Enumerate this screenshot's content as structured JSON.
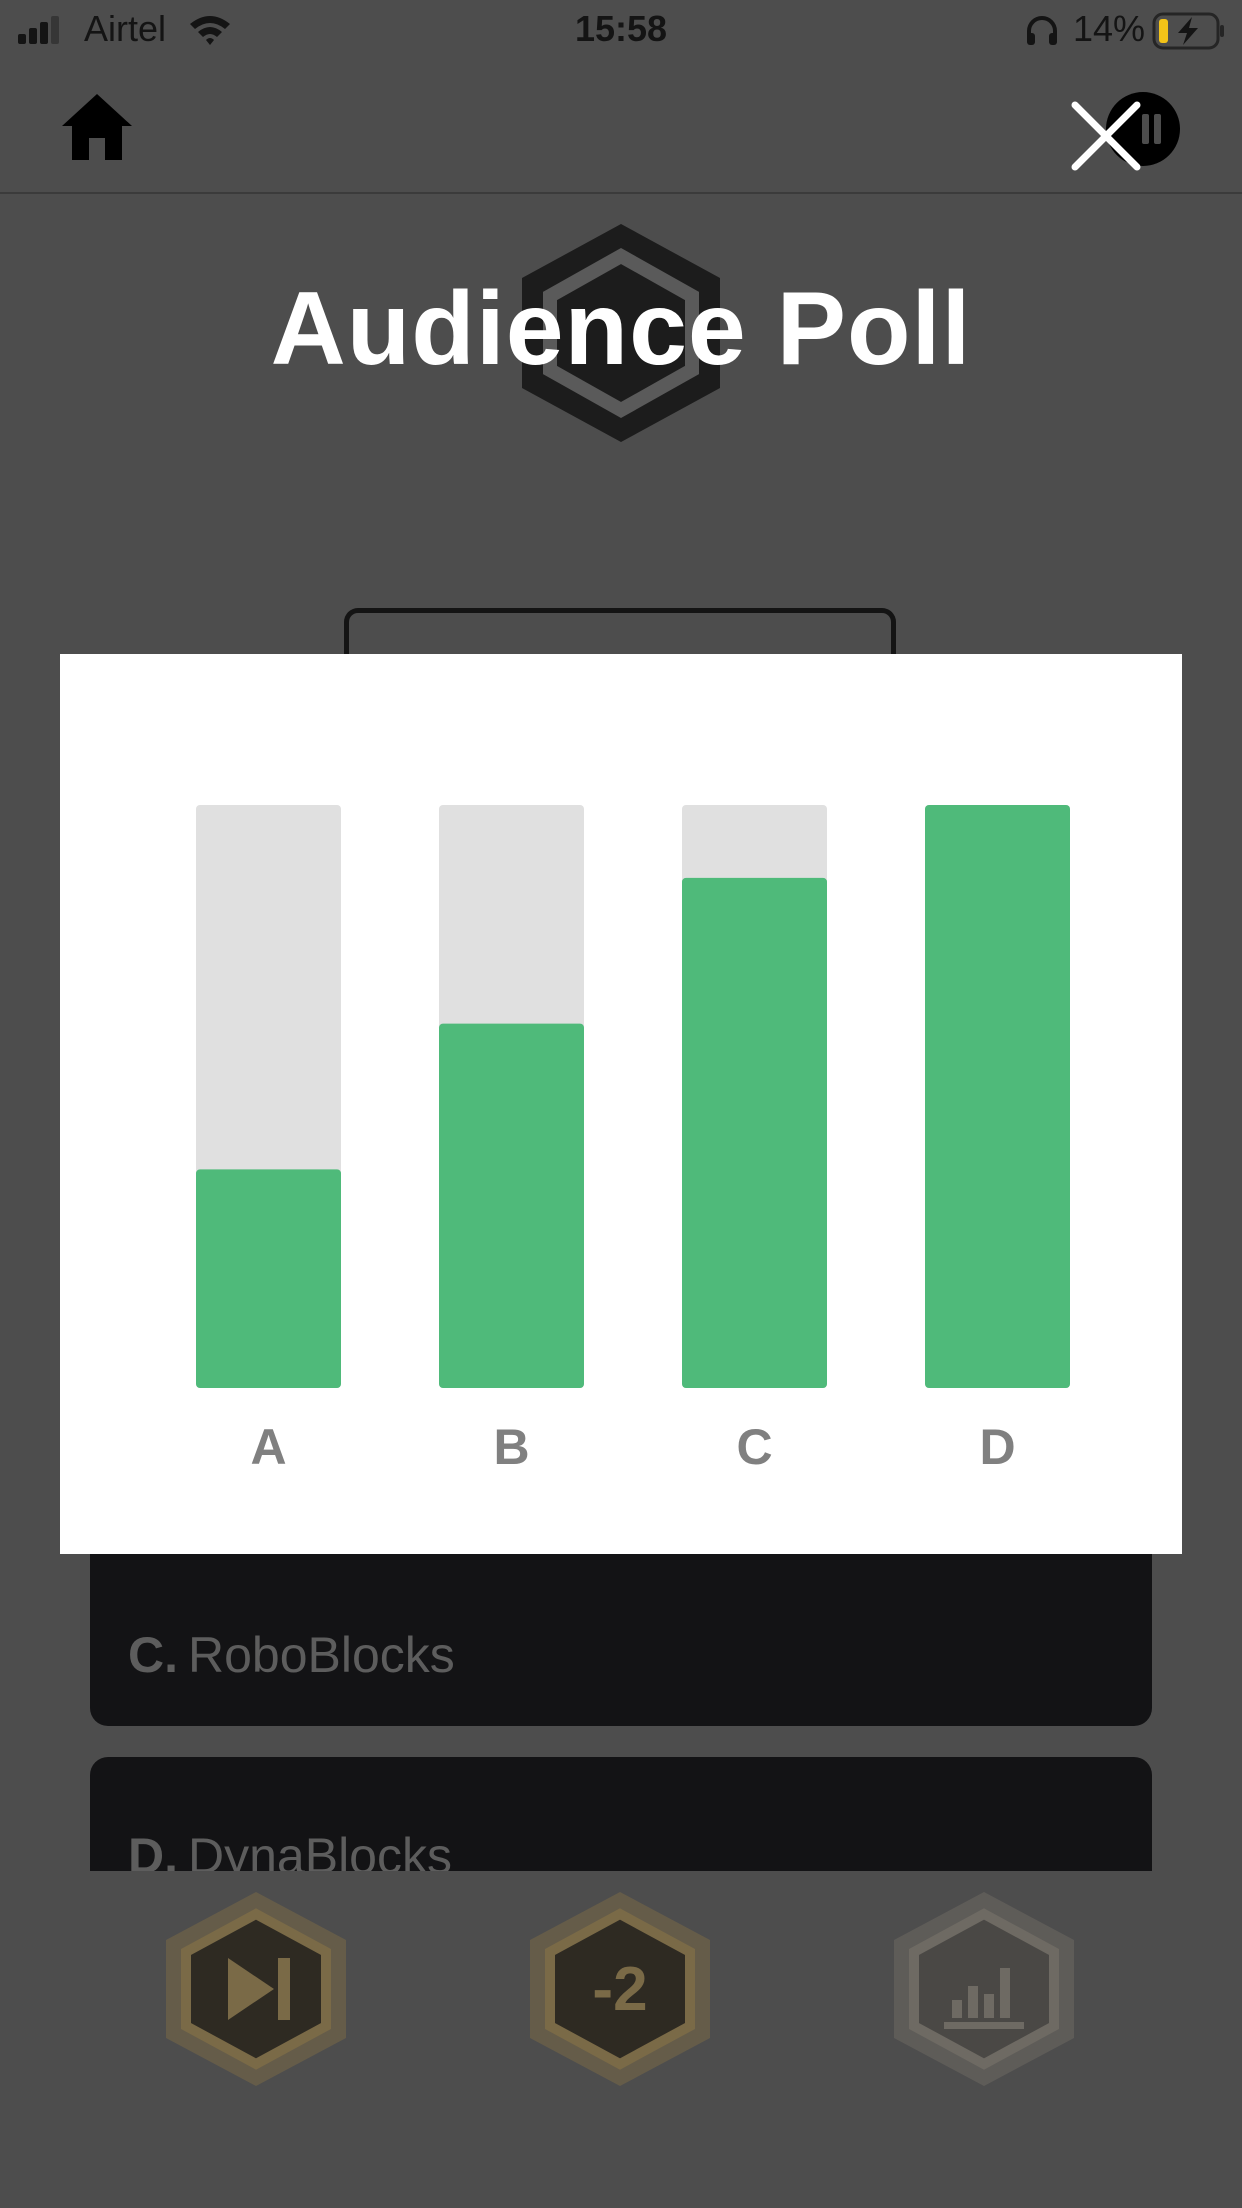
{
  "status_bar": {
    "carrier": "Airtel",
    "time": "15:58",
    "battery": "14%",
    "icons": [
      "signal-icon",
      "wifi-icon",
      "headphones-icon",
      "battery-charging-icon"
    ]
  },
  "top_bar": {
    "icons": [
      "home-icon",
      "close-icon",
      "pause-icon"
    ]
  },
  "title": "Audience Poll",
  "answers": {
    "c": {
      "letter": "C.",
      "text": "RoboBlocks"
    },
    "d": {
      "letter": "D.",
      "text": "DynaBlocks"
    }
  },
  "lifelines": {
    "icons": [
      "skip-question-icon",
      "minus-two-icon",
      "audience-poll-icon"
    ],
    "minus_two_label": "-2"
  },
  "colors": {
    "background_dim": "#4d4d4d",
    "bar_fill": "#4fba7a",
    "bar_track": "#e0e0e0",
    "label": "#808080",
    "lifeline_gold": "#7a6a47"
  },
  "chart_data": {
    "type": "bar",
    "categories": [
      "A",
      "B",
      "C",
      "D"
    ],
    "values": [
      37.5,
      62.5,
      87.5,
      100
    ],
    "ylim": [
      0,
      100
    ],
    "grid": false,
    "legend": "none"
  }
}
